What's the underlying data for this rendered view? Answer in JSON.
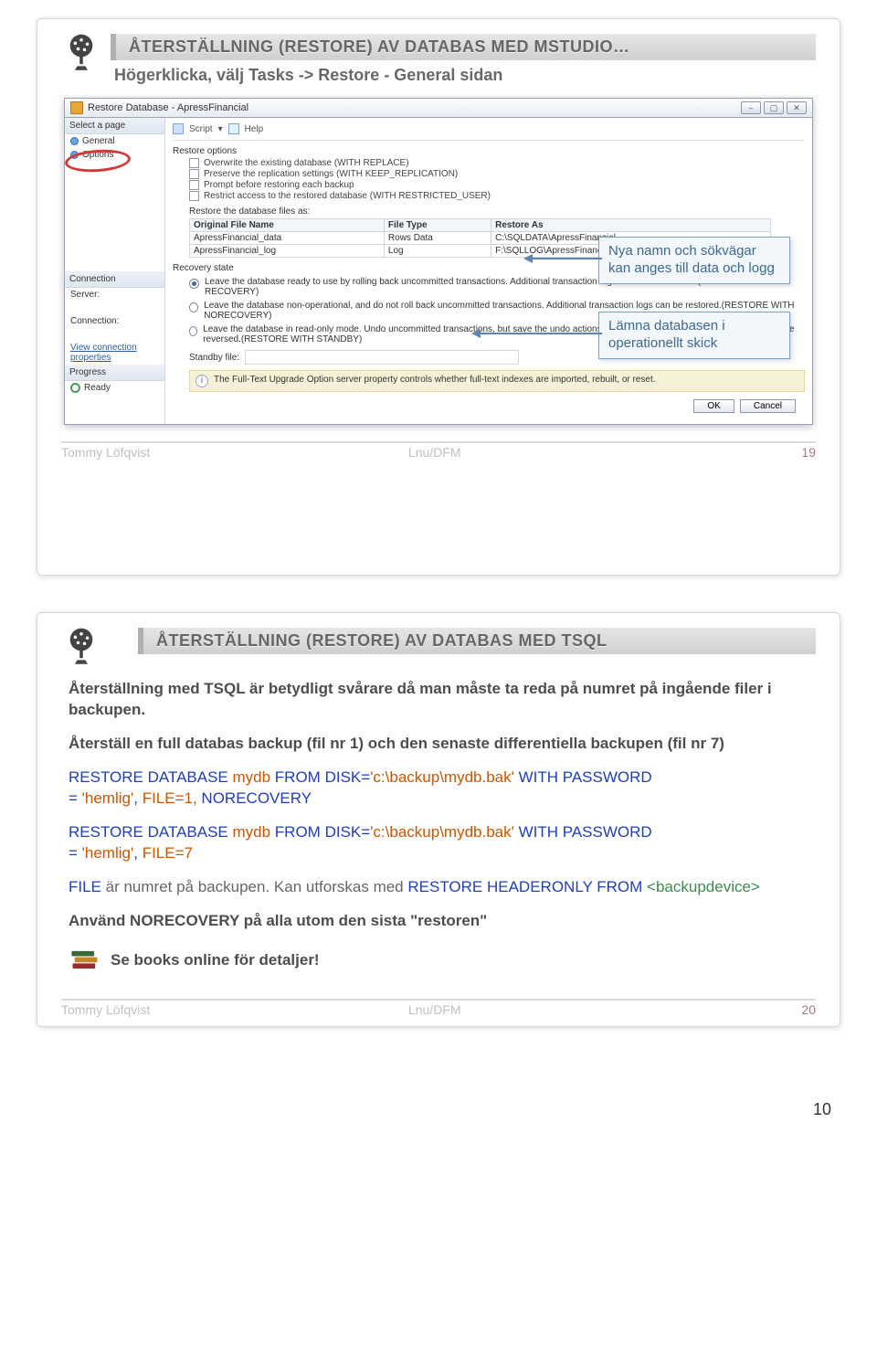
{
  "page_number": "10",
  "author": "Tommy Löfqvist",
  "org": "Lnu/DFM",
  "slide1": {
    "num": "19",
    "title": "ÅTERSTÄLLNING (RESTORE) AV DATABAS MED MSTUDIO…",
    "subtitle": "Högerklicka, välj Tasks -> Restore - General sidan",
    "callouts": {
      "c1": "Nya namn och sökvägar kan anges till data och logg",
      "c2": "Lämna databasen i operationellt skick"
    },
    "dialog": {
      "title": "Restore Database - ApressFinancial",
      "left": {
        "select": "Select a page",
        "general": "General",
        "options": "Options",
        "connection": "Connection",
        "server": "Server:",
        "conn": "Connection:",
        "view": "View connection properties",
        "progress": "Progress",
        "ready": "Ready"
      },
      "toolbar": {
        "script": "Script",
        "help": "Help"
      },
      "restore_options": "Restore options",
      "opts": {
        "o1": "Overwrite the existing database (WITH REPLACE)",
        "o2": "Preserve the replication settings (WITH KEEP_REPLICATION)",
        "o3": "Prompt before restoring each backup",
        "o4": "Restrict access to the restored database (WITH RESTRICTED_USER)"
      },
      "files_as": "Restore the database files as:",
      "tbl": {
        "h1": "Original File Name",
        "h2": "File Type",
        "h3": "Restore As",
        "r1c1": "ApressFinancial_data",
        "r1c2": "Rows Data",
        "r1c3": "C:\\SQLDATA\\ApressFinancial…",
        "r2c1": "ApressFinancial_log",
        "r2c2": "Log",
        "r2c3": "F:\\SQLLOG\\ApressFinancial.ldf"
      },
      "recovery": "Recovery state",
      "r1": "Leave the database ready to use by rolling back uncommitted transactions. Additional transaction logs cannot be restored.(RESTORE WITH RECOVERY)",
      "r2": "Leave the database non-operational, and do not roll back uncommitted transactions. Additional transaction logs can be restored.(RESTORE WITH NORECOVERY)",
      "r3": "Leave the database in read-only mode. Undo uncommitted transactions, but save the undo actions in a standby file so that recovery effects can be reversed.(RESTORE WITH STANDBY)",
      "standby": "Standby file:",
      "info": "The Full-Text Upgrade Option server property controls whether full-text indexes are imported, rebuilt, or reset.",
      "ok": "OK",
      "cancel": "Cancel"
    }
  },
  "slide2": {
    "num": "20",
    "title": "ÅTERSTÄLLNING (RESTORE) AV DATABAS MED TSQL",
    "p1": "Återställning med TSQL är betydligt svårare då man måste ta reda på numret på ingående filer i backupen.",
    "p2": "Återställ en full databas backup (fil nr 1) och den senaste differentiella backupen (fil nr 7)",
    "code1": {
      "a": "RESTORE",
      "b": " DATABASE ",
      "c": "mydb ",
      "d": "FROM",
      "e": " DISK=",
      "f": "'c:\\backup\\mydb.bak'",
      "g": " WITH",
      "h": " PASSWORD",
      "i": " = ",
      "j": "'hemlig'",
      "j2": ",",
      "k": " FILE=1,",
      "k2": " NORECOVERY"
    },
    "code2": {
      "a": "RESTORE",
      "b": " DATABASE ",
      "c": "mydb ",
      "d": "FROM",
      "e": " DISK=",
      "f": "'c:\\backup\\mydb.bak'",
      "g": " WITH",
      "h": " PASSWORD",
      "i": " = ",
      "j": "'hemlig'",
      "j2": ",",
      "k": " FILE=7"
    },
    "p3a": "FILE ",
    "p3b": "är numret på backupen. Kan utforskas med ",
    "p3c": "RESTORE HEADERONLY FROM ",
    "p3d": "<backupdevice>",
    "p4": "Använd NORECOVERY på alla utom den sista \"restoren\"",
    "p5": "Se books online för detaljer!"
  }
}
